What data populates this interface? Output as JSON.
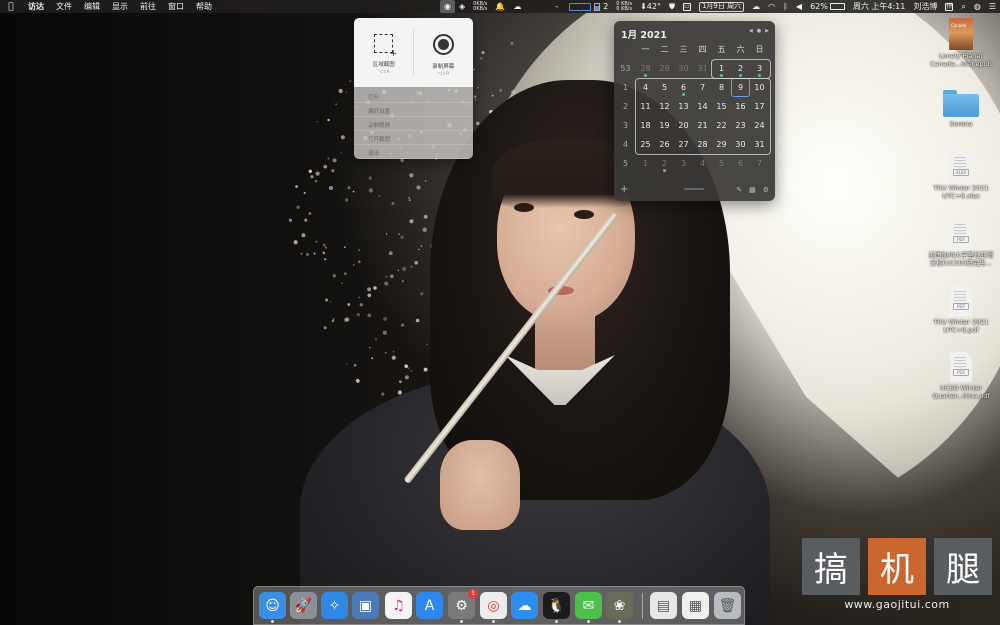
{
  "menubar": {
    "app_name": "访达",
    "menus": [
      "文件",
      "编辑",
      "显示",
      "前往",
      "窗口",
      "帮助"
    ],
    "net_up": "0KB/s",
    "net_down": "0KB/s",
    "net2_up": "0 KB/s",
    "net2_down": "0 KB/s",
    "cpu_count": "2",
    "temperature": "42°",
    "date_chip": "1月9日 周六",
    "battery": "62%",
    "clock": "周六 上午4:11",
    "user": "刘浩博",
    "ime": "拼"
  },
  "capture_tool": {
    "region_label": "区域截图",
    "region_key": "⌥⇧A",
    "record_label": "录制屏幕",
    "record_key": "⌥⇧R",
    "list_items": [
      "打开",
      "偏好设置",
      "录制视频",
      "打开截图",
      "退出"
    ]
  },
  "calendar": {
    "title": "1月 2021",
    "weekdays": [
      "一",
      "二",
      "三",
      "四",
      "五",
      "六",
      "日"
    ],
    "weeks": [
      {
        "num": "53",
        "days": [
          "28",
          "29",
          "30",
          "31",
          "1",
          "2",
          "3"
        ]
      },
      {
        "num": "1",
        "days": [
          "4",
          "5",
          "6",
          "7",
          "8",
          "9",
          "10"
        ]
      },
      {
        "num": "2",
        "days": [
          "11",
          "12",
          "13",
          "14",
          "15",
          "16",
          "17"
        ]
      },
      {
        "num": "3",
        "days": [
          "18",
          "19",
          "20",
          "21",
          "22",
          "23",
          "24"
        ]
      },
      {
        "num": "4",
        "days": [
          "25",
          "26",
          "27",
          "28",
          "29",
          "30",
          "31"
        ]
      },
      {
        "num": "5",
        "days": [
          "1",
          "2",
          "3",
          "4",
          "5",
          "6",
          "7"
        ]
      }
    ],
    "today": "9",
    "accent_color": "#6aa0e6",
    "event_dot_color": "#5cc18a"
  },
  "desktop": {
    "icons": [
      {
        "type": "book",
        "label": "Lonely Planet Canada...ide).epub",
        "cover_text": "Canada"
      },
      {
        "type": "folder",
        "label": "Serena"
      },
      {
        "type": "doc",
        "label": "TRU Winter 2021 UTC+8.xlsx",
        "badge": "XLSX"
      },
      {
        "type": "doc",
        "label": "美国加州大学圣地亚哥分校(UCSD)研究生…",
        "badge": "PDF"
      },
      {
        "type": "doc",
        "label": "TRU Winter 2021 UTC+8.pdf",
        "badge": "PDF"
      },
      {
        "type": "doc",
        "label": "UCSD Winter Quarter...hina.pdf",
        "badge": "PDF"
      }
    ]
  },
  "dock": {
    "apps": [
      {
        "name": "finder",
        "glyph": "☺",
        "color": "#3a8ee6",
        "running": true
      },
      {
        "name": "launchpad",
        "glyph": "🚀",
        "color": "#8a8f98",
        "running": false
      },
      {
        "name": "safari",
        "glyph": "✧",
        "color": "#2f88e3",
        "running": false
      },
      {
        "name": "preview",
        "glyph": "▣",
        "color": "#4a7bb7",
        "running": false
      },
      {
        "name": "music",
        "glyph": "♫",
        "color": "#f4f4f4",
        "running": false
      },
      {
        "name": "app-store",
        "glyph": "A",
        "color": "#2f86ee",
        "running": false
      },
      {
        "name": "system-preferences",
        "glyph": "⚙",
        "color": "#7a7a7a",
        "running": true,
        "badge": "1"
      },
      {
        "name": "chrome",
        "glyph": "◎",
        "color": "#ececec",
        "running": true
      },
      {
        "name": "baidu-netdisk",
        "glyph": "☁",
        "color": "#2e8ef0",
        "running": false
      },
      {
        "name": "qq",
        "glyph": "🐧",
        "color": "#1b1b1b",
        "running": true
      },
      {
        "name": "wechat",
        "glyph": "✉",
        "color": "#4bc04b",
        "running": true
      },
      {
        "name": "photos",
        "glyph": "❀",
        "color": "#6a6a58",
        "running": true
      }
    ],
    "right_items": [
      {
        "name": "downloads-stack",
        "glyph": "▤",
        "color": "#e8e8e8"
      },
      {
        "name": "documents-stack",
        "glyph": "▦",
        "color": "#f0f0f0"
      },
      {
        "name": "trash",
        "glyph": "🗑",
        "color": "#b8bcc2"
      }
    ]
  },
  "watermark": {
    "chars": [
      "搞",
      "机",
      "腿"
    ],
    "url": "www.gaojitui.com",
    "colors": [
      "#5a5d60",
      "#c9672f",
      "#5a5d60"
    ]
  }
}
